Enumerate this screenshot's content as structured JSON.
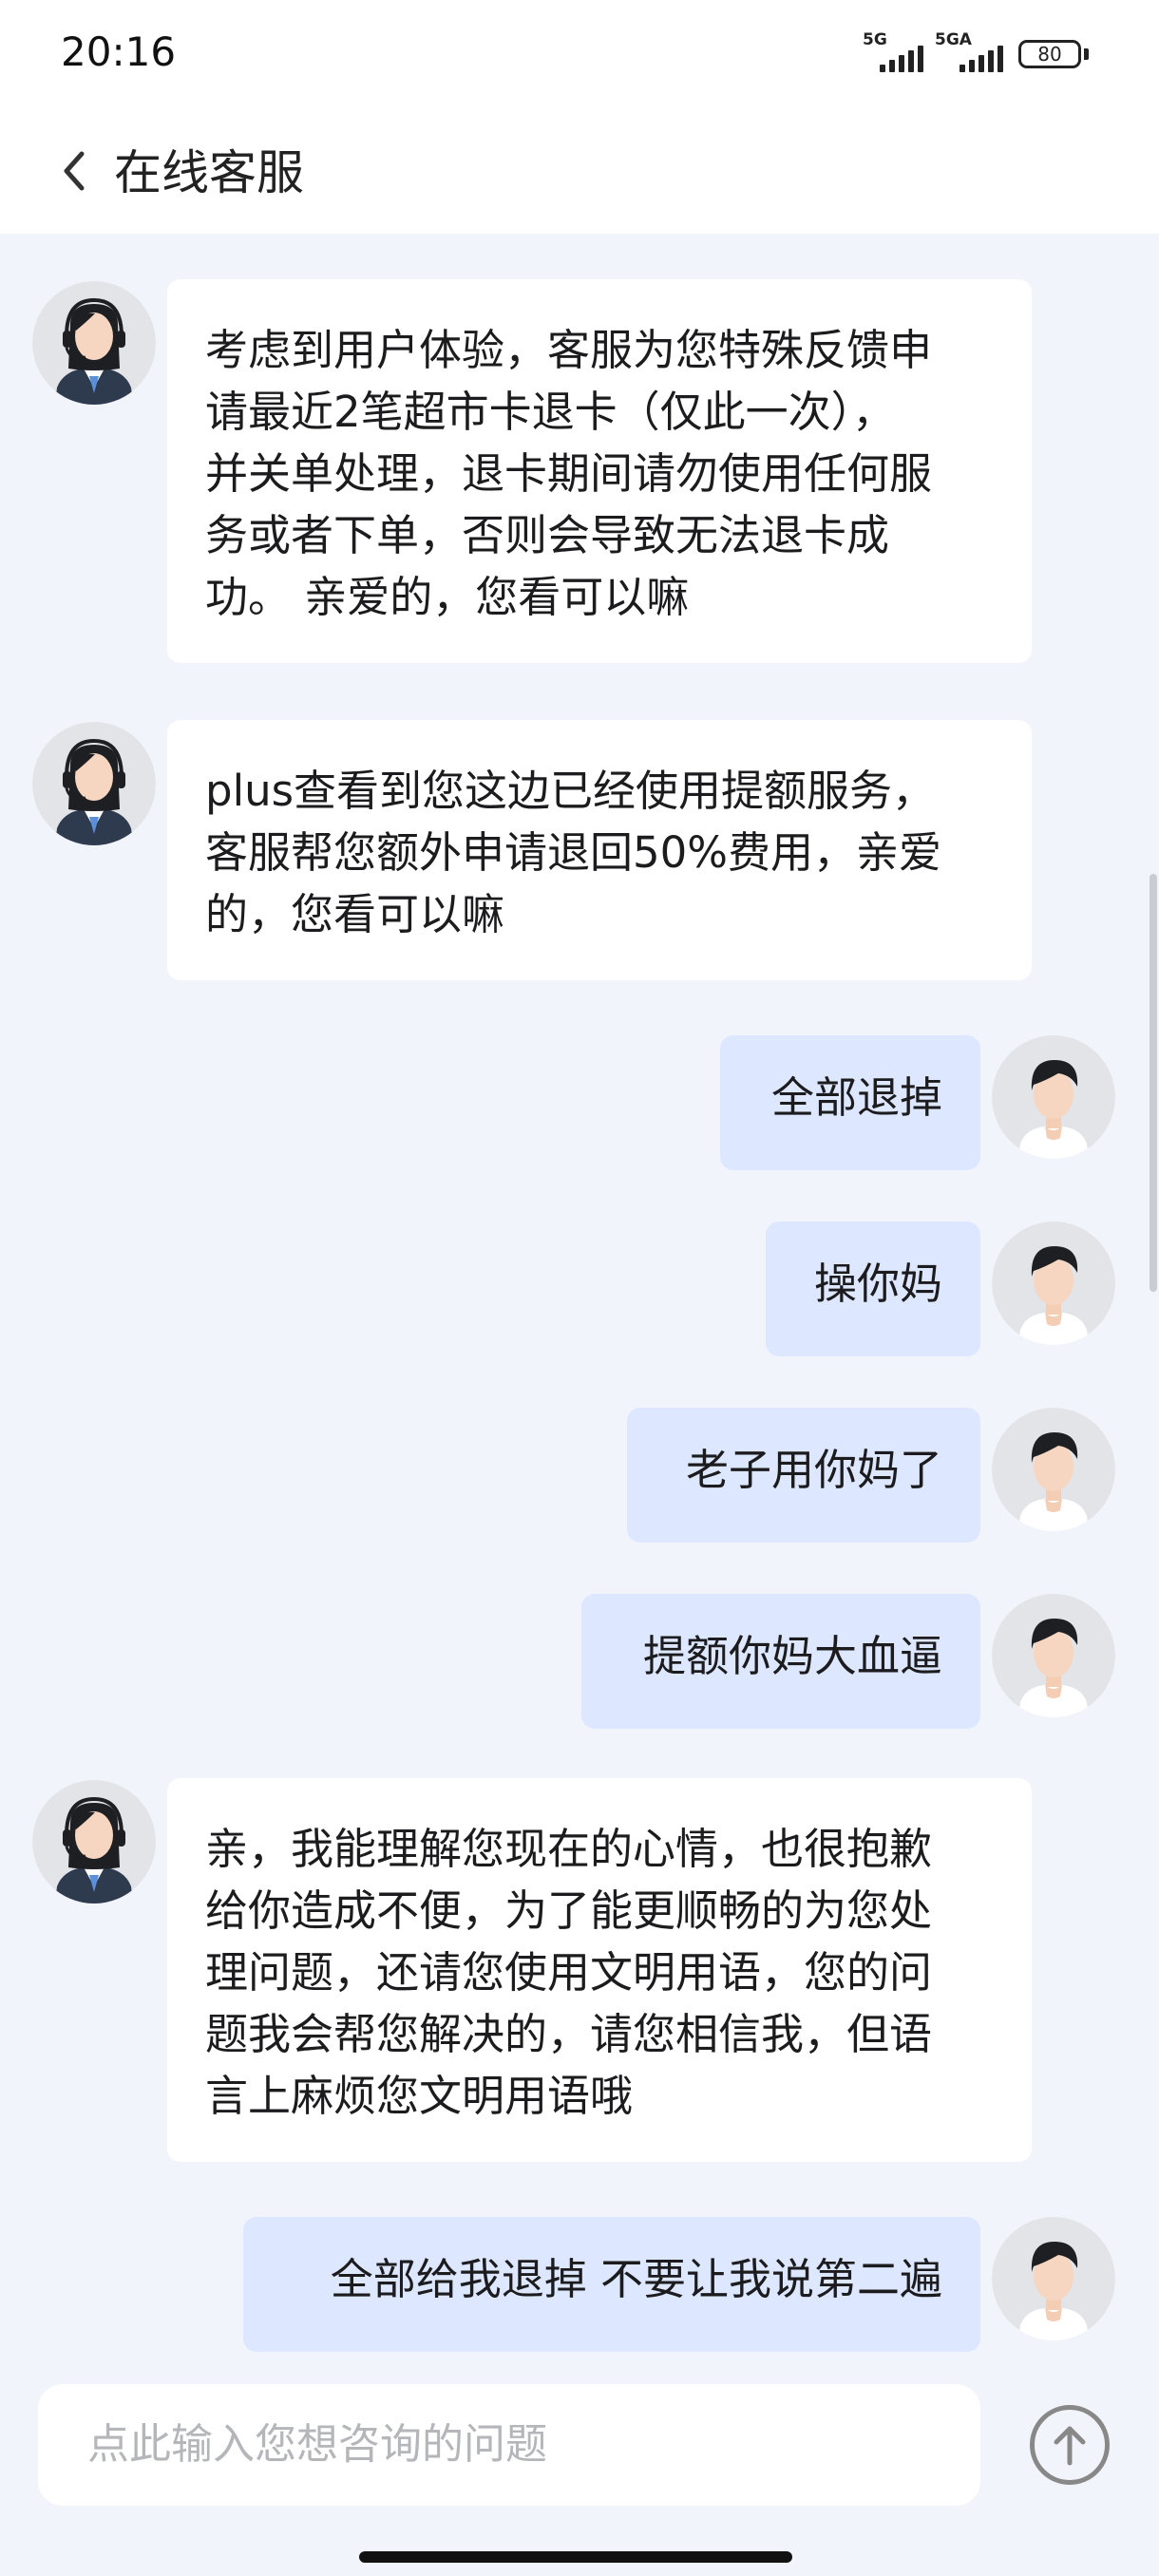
{
  "status_bar": {
    "time": "20:16",
    "signal_1": "5G",
    "signal_2": "5GA",
    "battery": "80"
  },
  "header": {
    "title": "在线客服"
  },
  "messages": [
    {
      "sender": "agent",
      "text": "考虑到用户体验，客服为您特殊反馈申\n请最近2笔超市卡退卡（仅此一次），\n并关单处理，退卡期间请勿使用任何服\n务或者下单，否则会导致无法退卡成\n功。 亲爱的，您看可以嘛"
    },
    {
      "sender": "agent",
      "text": "plus查看到您这边已经使用提额服务，\n客服帮您额外申请退回50%费用，亲爱\n的，您看可以嘛"
    },
    {
      "sender": "user",
      "text": "全部退掉"
    },
    {
      "sender": "user",
      "text": "操你妈"
    },
    {
      "sender": "user",
      "text": "老子用你妈了"
    },
    {
      "sender": "user",
      "text": "提额你妈大血逼"
    },
    {
      "sender": "agent",
      "text": "亲，我能理解您现在的心情，也很抱歉\n给你造成不便，为了能更顺畅的为您处\n理问题，还请您使用文明用语，您的问\n题我会帮您解决的，请您相信我，但语\n言上麻烦您文明用语哦"
    },
    {
      "sender": "user",
      "text": "全部给我退掉 不要让我说第二遍"
    }
  ],
  "input": {
    "placeholder": "点此输入您想咨询的问题"
  },
  "icons": {
    "back": "chevron-left-icon",
    "send": "arrow-up-circle-icon",
    "agent_avatar": "customer-service-avatar-icon",
    "user_avatar": "user-avatar-icon"
  },
  "colors": {
    "agent_bubble": "#ffffff",
    "user_bubble": "#dde7ff",
    "background": "#f2f4fb"
  }
}
